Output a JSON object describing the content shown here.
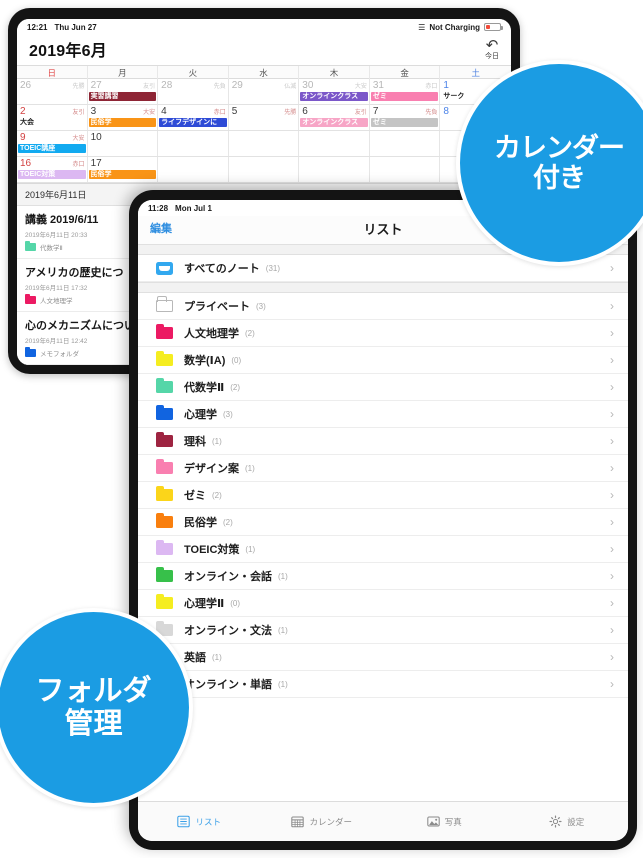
{
  "back_device": {
    "statusbar": {
      "time": "12:21",
      "date": "Thu Jun 27",
      "wifi": "wifi-icon",
      "charge": "Not Charging"
    },
    "calendar": {
      "title": "2019年6月",
      "today_button": "今日",
      "weekday_headers": [
        "日",
        "月",
        "火",
        "水",
        "木",
        "金",
        "土"
      ],
      "weeks": [
        {
          "days": [
            {
              "num": "26",
              "rokuyo": "先勝",
              "muted": true,
              "events": []
            },
            {
              "num": "27",
              "rokuyo": "友引",
              "muted": true,
              "events": [
                {
                  "text": "実習講習",
                  "color": "#8e2535",
                  "span": 1
                }
              ]
            },
            {
              "num": "28",
              "rokuyo": "先負",
              "muted": true,
              "events": []
            },
            {
              "num": "29",
              "rokuyo": "仏滅",
              "muted": true,
              "events": []
            },
            {
              "num": "30",
              "rokuyo": "大安",
              "muted": true,
              "events": [
                {
                  "text": "オンラインクラス",
                  "color": "#7b57c9",
                  "span": 1
                }
              ]
            },
            {
              "num": "31",
              "rokuyo": "赤口",
              "muted": true,
              "events": [
                {
                  "text": "ゼミ",
                  "color": "#f97fb0",
                  "span": 1
                }
              ]
            },
            {
              "num": "1",
              "rokuyo": "",
              "sat": true,
              "events": [
                {
                  "text": "サーク",
                  "color": "transparent",
                  "plain": true
                }
              ]
            }
          ]
        },
        {
          "days": [
            {
              "num": "2",
              "rokuyo": "友引",
              "sun": true,
              "events": [
                {
                  "text": "大会",
                  "color": "transparent",
                  "plain": true
                }
              ]
            },
            {
              "num": "3",
              "rokuyo": "大安",
              "events": [
                {
                  "text": "民俗学",
                  "color": "#f99416",
                  "span": 1
                }
              ]
            },
            {
              "num": "4",
              "rokuyo": "赤口",
              "events": [
                {
                  "text": "ライフデザインに",
                  "color": "#2e4bd6",
                  "span": 1
                }
              ]
            },
            {
              "num": "5",
              "rokuyo": "先勝",
              "events": []
            },
            {
              "num": "6",
              "rokuyo": "友引",
              "events": [
                {
                  "text": "オンラインクラス",
                  "color": "#f7a5c6",
                  "span": 1
                }
              ]
            },
            {
              "num": "7",
              "rokuyo": "先負",
              "events": [
                {
                  "text": "ゼミ",
                  "color": "#c4c4c4",
                  "span": 1
                }
              ]
            },
            {
              "num": "8",
              "rokuyo": "",
              "sat": true,
              "events": []
            }
          ]
        },
        {
          "days": [
            {
              "num": "9",
              "rokuyo": "大安",
              "sun": true,
              "events": [
                {
                  "text": "TOEIC講座",
                  "color": "#12aaf0",
                  "span": 1
                }
              ]
            },
            {
              "num": "10",
              "rokuyo": "",
              "events": []
            },
            {
              "num": "",
              "rokuyo": "",
              "events": []
            },
            {
              "num": "",
              "rokuyo": "",
              "events": []
            },
            {
              "num": "",
              "rokuyo": "",
              "events": []
            },
            {
              "num": "",
              "rokuyo": "",
              "events": []
            },
            {
              "num": "",
              "rokuyo": "",
              "events": []
            }
          ]
        },
        {
          "days": [
            {
              "num": "16",
              "rokuyo": "赤口",
              "sun": true,
              "events": [
                {
                  "text": "TOEIC対策",
                  "color": "#dcb8f2",
                  "span": 1
                }
              ]
            },
            {
              "num": "17",
              "rokuyo": "",
              "events": [
                {
                  "text": "民俗学",
                  "color": "#f99416",
                  "span": 1
                }
              ]
            },
            {
              "num": "",
              "rokuyo": "",
              "events": []
            },
            {
              "num": "",
              "rokuyo": "",
              "events": []
            },
            {
              "num": "",
              "rokuyo": "",
              "events": []
            },
            {
              "num": "",
              "rokuyo": "",
              "events": []
            },
            {
              "num": "",
              "rokuyo": "",
              "events": []
            }
          ]
        }
      ]
    },
    "notes_header": "2019年6月11日",
    "notes": [
      {
        "title": "講義 2019/6/11",
        "datetime": "2019年6月11日 20:33",
        "folder": "代数学Ⅱ",
        "folder_color": "#55d6a8"
      },
      {
        "title": "アメリカの歴史につ",
        "datetime": "2019年6月11日 17:32",
        "folder": "人文地理学",
        "folder_color": "#ec1a63"
      },
      {
        "title": "心のメカニズムについ",
        "datetime": "2019年6月11日 12:42",
        "folder": "メモフォルダ",
        "folder_color": "#1164e0"
      }
    ]
  },
  "front_device": {
    "statusbar": {
      "time": "11:28",
      "date": "Mon Jul 1"
    },
    "nav": {
      "edit": "編集",
      "title": "リスト"
    },
    "inbox": {
      "label": "すべてのノート",
      "count": "(31)",
      "icon": "inbox-icon"
    },
    "folders": [
      {
        "label": "プライベート",
        "count": "(3)",
        "color": "outline"
      },
      {
        "label": "人文地理学",
        "count": "(2)",
        "color": "#ec1a63"
      },
      {
        "label": "数学(ⅠA)",
        "count": "(0)",
        "color": "#f5ed20"
      },
      {
        "label": "代数学Ⅱ",
        "count": "(2)",
        "color": "#55d6a8"
      },
      {
        "label": "心理学",
        "count": "(3)",
        "color": "#1164e0"
      },
      {
        "label": "理科",
        "count": "(1)",
        "color": "#9e2441"
      },
      {
        "label": "デザイン案",
        "count": "(1)",
        "color": "#f97fb0"
      },
      {
        "label": "ゼミ",
        "count": "(2)",
        "color": "#fbd51a"
      },
      {
        "label": "民俗学",
        "count": "(2)",
        "color": "#f97f0e"
      },
      {
        "label": "TOEIC対策",
        "count": "(1)",
        "color": "#dcb8f2"
      },
      {
        "label": "オンライン・会話",
        "count": "(1)",
        "color": "#37c04a"
      },
      {
        "label": "心理学Ⅱ",
        "count": "(0)",
        "color": "#f5ed20"
      },
      {
        "label": "オンライン・文法",
        "count": "(1)",
        "color": "#d8d8d8"
      },
      {
        "label": "英語",
        "count": "(1)",
        "color": "#d8d8d8"
      },
      {
        "label": "オンライン・単語",
        "count": "(1)",
        "color": "#d8d8d8"
      }
    ],
    "tabs": [
      {
        "label": "リスト",
        "icon": "list-icon",
        "active": true
      },
      {
        "label": "カレンダー",
        "icon": "calendar-icon",
        "active": false
      },
      {
        "label": "写真",
        "icon": "photo-icon",
        "active": false
      },
      {
        "label": "設定",
        "icon": "gear-icon",
        "active": false
      }
    ]
  },
  "badges": {
    "calendar": {
      "line1": "カレンダー",
      "line2": "付き",
      "color": "#1b9ce3"
    },
    "folder": {
      "line1": "フォルダ",
      "line2": "管理",
      "color": "#1b9ce3"
    }
  }
}
